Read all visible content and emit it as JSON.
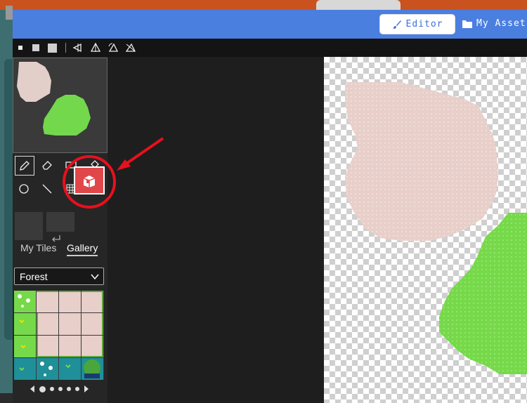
{
  "topbar": {
    "editor_label": "Editor",
    "assets_label": "My Assets"
  },
  "toolstrip": {
    "icons": [
      "brush-size-small-icon",
      "brush-size-medium-icon",
      "brush-size-large-icon",
      "mirror-left-icon",
      "mirror-vertical-icon",
      "rotate-icon",
      "flip-icon"
    ]
  },
  "tools": {
    "row1": [
      "pencil-icon",
      "eraser-icon",
      "rectangle-icon",
      "fill-bucket-icon"
    ],
    "row2": [
      "circle-icon",
      "line-icon",
      "tile-grid-icon",
      "hand-icon"
    ],
    "active": "pencil-icon"
  },
  "tiles": {
    "tab_my": "My Tiles",
    "tab_gallery": "Gallery",
    "active_tab": "Gallery",
    "category": "Forest"
  },
  "colors": {
    "accent": "#4a7fe0",
    "tile_pink": "#e8cfca",
    "tile_green": "#76d94a",
    "highlight_button": "#e0474a",
    "annotation": "#e8101c"
  }
}
